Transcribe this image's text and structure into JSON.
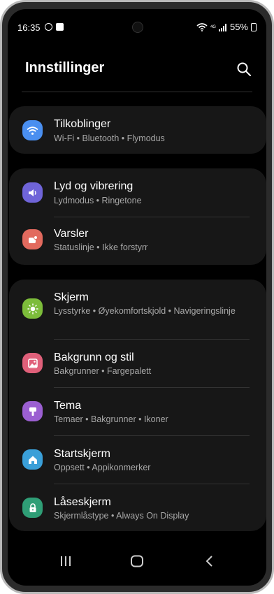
{
  "status_bar": {
    "time": "16:35",
    "battery": "55%",
    "network": "4G"
  },
  "header": {
    "title": "Innstillinger"
  },
  "colors": {
    "connections": "#4a8ff0",
    "sound": "#6f64d8",
    "notifications": "#e26a5e",
    "display": "#7cbc3a",
    "wallpaper": "#e0607a",
    "themes": "#9b5fd1",
    "home": "#3a9fd8",
    "lock": "#2f9e76"
  },
  "groups": [
    {
      "items": [
        {
          "title": "Tilkoblinger",
          "subtitle": "Wi-Fi  •  Bluetooth  •  Flymodus",
          "icon": "wifi-icon"
        }
      ]
    },
    {
      "items": [
        {
          "title": "Lyd og vibrering",
          "subtitle": "Lydmodus  •  Ringetone",
          "icon": "sound-icon"
        },
        {
          "title": "Varsler",
          "subtitle": "Statuslinje  •  Ikke forstyrr",
          "icon": "notification-icon"
        }
      ]
    },
    {
      "items": [
        {
          "title": "Skjerm",
          "subtitle": "Lysstyrke  •  Øyekomfortskjold  •  Navigeringslinje",
          "icon": "brightness-icon"
        },
        {
          "title": "Bakgrunn og stil",
          "subtitle": "Bakgrunner  •  Fargepalett",
          "icon": "wallpaper-icon"
        },
        {
          "title": "Tema",
          "subtitle": "Temaer  •  Bakgrunner  •  Ikoner",
          "icon": "theme-brush-icon"
        },
        {
          "title": "Startskjerm",
          "subtitle": "Oppsett  •  Appikonmerker",
          "icon": "home-icon"
        },
        {
          "title": "Låseskjerm",
          "subtitle": "Skjermlåstype  •  Always On Display",
          "icon": "lock-icon"
        }
      ]
    }
  ]
}
